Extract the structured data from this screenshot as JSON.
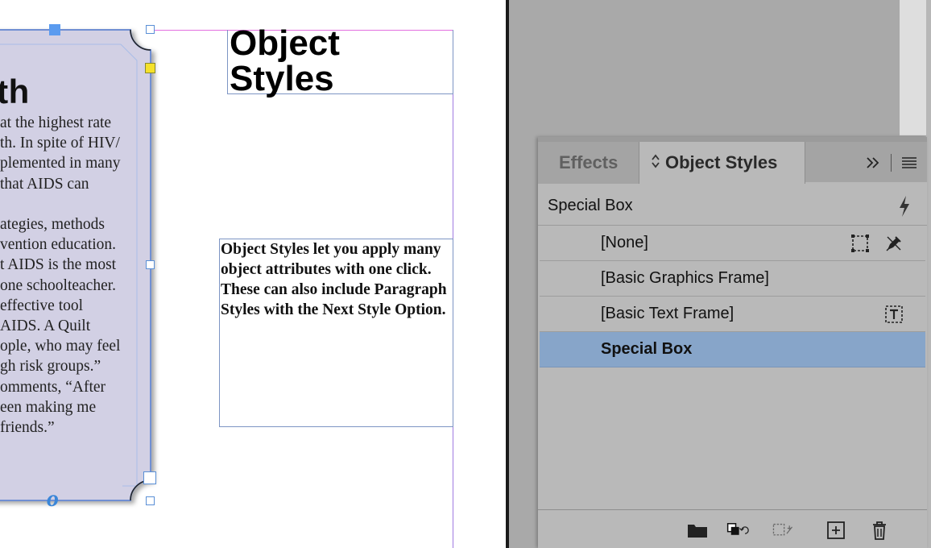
{
  "document": {
    "special_box": {
      "heading": "uth",
      "lines": [
        "at the highest rate",
        "th. In spite of HIV/",
        "plemented in many",
        " that AIDS can",
        "",
        "ategies, methods",
        "vention education.",
        "t AIDS is the most",
        "one schoolteacher.",
        " effective tool",
        "AIDS. A Quilt",
        "ople, who may feel",
        "gh risk groups.”",
        "omments, “After",
        "een making me",
        "friends.”"
      ],
      "overset_glyph": "o"
    },
    "title_frame": {
      "lines": [
        "Object",
        "Styles"
      ]
    },
    "body_frame": {
      "text": "Object Styles let you apply many object attributes with one click. These can also include Paragraph Styles with the Next Style Option."
    }
  },
  "panel": {
    "tabs": [
      {
        "label": "Effects",
        "active": false
      },
      {
        "label": "Object Styles",
        "active": true
      }
    ],
    "collapse_icon": "double-chevron-right-icon",
    "menu_icon": "hamburger-menu-icon",
    "current_style": "Special Box",
    "current_style_icon": "lightning-bolt-icon",
    "styles": [
      {
        "label": "[None]",
        "icons": [
          "dashed-frame-icon",
          "pen-edit-icon"
        ],
        "selected": false
      },
      {
        "label": "[Basic Graphics Frame]",
        "icons": [],
        "selected": false
      },
      {
        "label": "[Basic Text Frame]",
        "icons": [
          "text-frame-icon"
        ],
        "selected": false
      },
      {
        "label": "Special Box",
        "icons": [],
        "selected": true
      }
    ],
    "footer_buttons": [
      "new-group-folder-icon",
      "clear-overrides-icon",
      "clear-attributes-icon",
      "new-style-icon",
      "delete-style-icon"
    ]
  },
  "colors": {
    "selection": "#87a5c9",
    "frame_fill": "#d2d0e4",
    "frame_stroke": "#6f8fd3",
    "margin_guide": "#e26ee0"
  }
}
